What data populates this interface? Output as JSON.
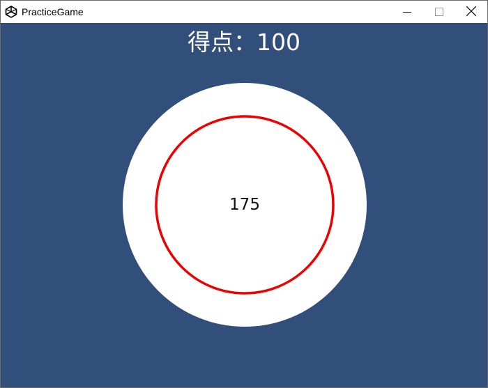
{
  "window": {
    "title": "PracticeGame",
    "app_icon": "unity-icon",
    "controls": [
      "minimize-icon",
      "maximize-icon",
      "close-icon"
    ]
  },
  "game": {
    "score_text": "得点：100",
    "target_value": "175",
    "colors": {
      "background": "#324f7b",
      "target_fill": "#ffffff",
      "ring": "#ee0000"
    }
  }
}
